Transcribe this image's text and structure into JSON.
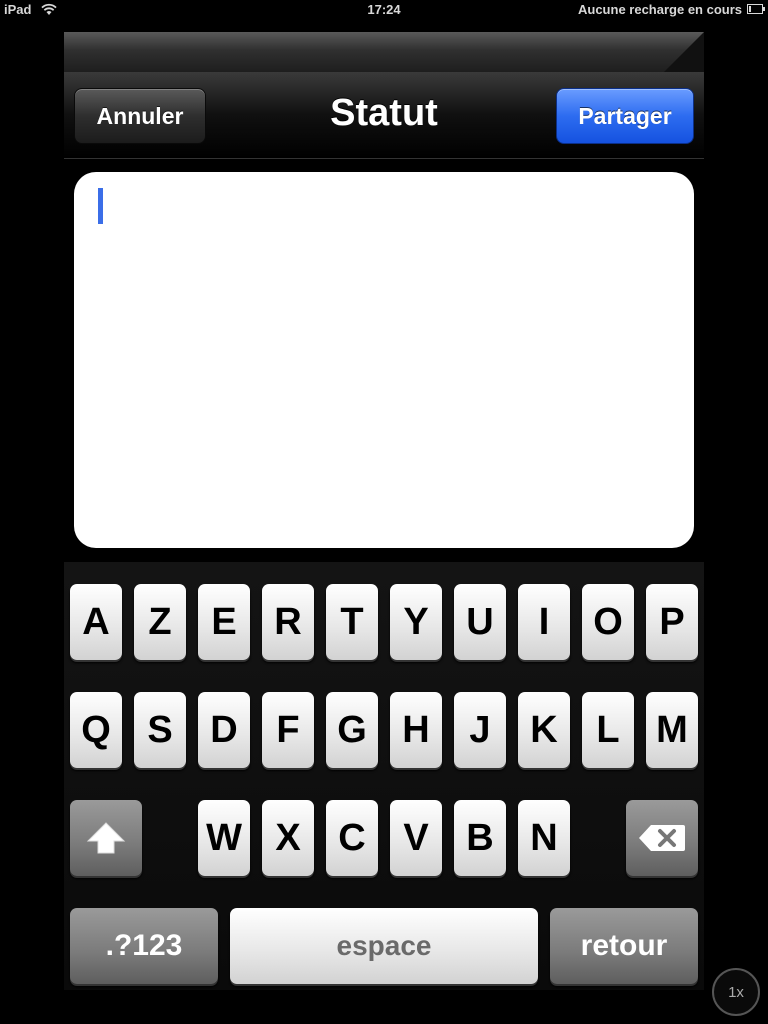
{
  "status_bar": {
    "device": "iPad",
    "time": "17:24",
    "battery_text": "Aucune recharge en cours",
    "wifi_icon": "wifi-icon",
    "battery_icon": "battery-icon"
  },
  "navbar": {
    "title": "Statut",
    "cancel_label": "Annuler",
    "share_label": "Partager",
    "share_color": "#2d6cf0"
  },
  "compose": {
    "text": ""
  },
  "keyboard": {
    "row1": [
      "A",
      "Z",
      "E",
      "R",
      "T",
      "Y",
      "U",
      "I",
      "O",
      "P"
    ],
    "row2": [
      "Q",
      "S",
      "D",
      "F",
      "G",
      "H",
      "J",
      "K",
      "L",
      "M"
    ],
    "row3": [
      "W",
      "X",
      "C",
      "V",
      "B",
      "N"
    ],
    "shift_icon": "shift-icon",
    "delete_icon": "delete-icon",
    "numbers_label": ".?123",
    "space_label": "espace",
    "return_label": "retour"
  },
  "zoom_label": "1x"
}
